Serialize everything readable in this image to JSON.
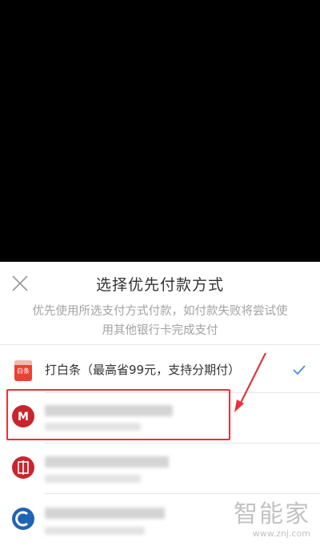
{
  "sheet": {
    "title": "选择优先付款方式",
    "description": "优先使用所选支付方式付款，如付款失败将尝试使用其他银行卡完成支付"
  },
  "payment_options": [
    {
      "icon": "baitiao-icon",
      "icon_text": "白条",
      "label": "打白条（最高省99元，支持分期付）",
      "selected": true
    },
    {
      "icon": "cmb-bank-icon",
      "label_hidden": true
    },
    {
      "icon": "citic-bank-icon",
      "label_hidden": true
    },
    {
      "icon": "ccb-bank-icon",
      "label_hidden": true
    }
  ],
  "watermark": {
    "logo": "智能家",
    "url": "www.znj.com"
  },
  "colors": {
    "accent_check": "#4a90e2",
    "highlight": "#e8323a",
    "baitiao": "#e94235"
  }
}
